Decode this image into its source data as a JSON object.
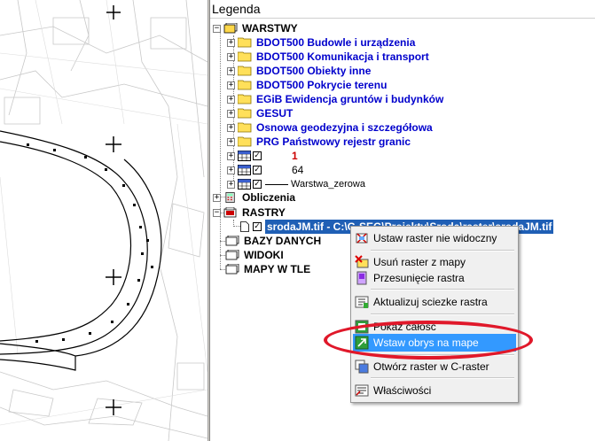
{
  "legend": {
    "title": "Legenda",
    "root_warstwy": "WARSTWY",
    "groups": [
      "BDOT500 Budowle i urządzenia",
      "BDOT500 Komunikacja i transport",
      "BDOT500 Obiekty inne",
      "BDOT500 Pokrycie terenu",
      "EGiB Ewidencja gruntów i budynków",
      "GESUT",
      "Osnowa geodezyjna i szczegółowa",
      "PRG Państwowy rejestr granic"
    ],
    "layers": [
      {
        "label": "1",
        "color": "#cc0000"
      },
      {
        "label": "64",
        "color": "#000000"
      },
      {
        "label": "Warstwa_zerowa",
        "color": "#000000"
      }
    ],
    "obliczenia": "Obliczenia",
    "rastry": "RASTRY",
    "raster_item": "srodaJM.tif - C:\\G-SEG\\Projekty\\Sroda\\raster\\srodaJM.tif",
    "bazy_danych": "BAZY DANYCH",
    "widoki": "WIDOKI",
    "mapy_w_tle": "MAPY W TLE"
  },
  "menu": {
    "items": [
      "Ustaw raster nie widoczny",
      "Usuń raster z mapy",
      "Przesunięcie rastra",
      "Aktualizuj sciezke rastra",
      "Pokaż całość",
      "Wstaw obrys na mape",
      "Otwórz raster w C-raster",
      "Właściwości"
    ],
    "highlight_color": "#3399ff"
  },
  "annotation_color": "#e0182a"
}
